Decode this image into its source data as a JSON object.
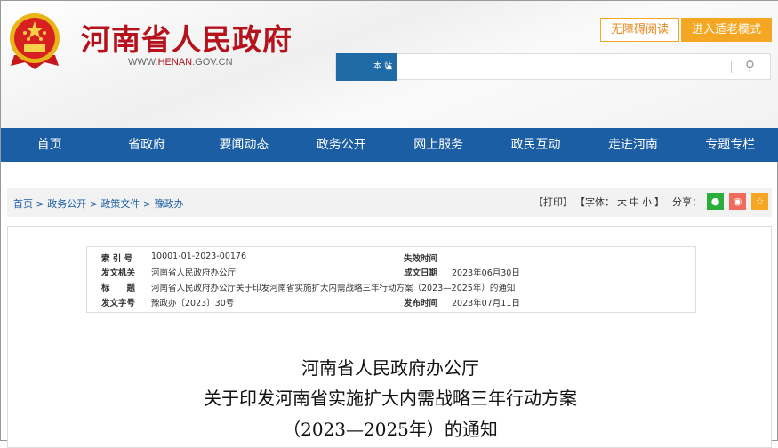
{
  "header": {
    "title": "河南省人民政府",
    "url_prefix": "WWW.",
    "url_mid": "HENAN",
    "url_suffix": ".GOV.CN",
    "accessible_label": "无障碍阅读",
    "elder_label": "进入适老模式",
    "search_scope": "本 站",
    "search_placeholder": ""
  },
  "nav": [
    "首页",
    "省政府",
    "要闻动态",
    "政务公开",
    "网上服务",
    "政民互动",
    "走进河南",
    "专题专栏"
  ],
  "breadcrumb": [
    "首页",
    "政务公开",
    "政策文件",
    "豫政办"
  ],
  "tools": {
    "print": "【打印】",
    "font_label": "【字体：",
    "large": "大",
    "medium": "中",
    "small": "小",
    "font_end": "】",
    "share": "分享："
  },
  "meta": {
    "index_label": "索 引 号",
    "index": "10001-01-2023-00176",
    "expire_label": "失效时间",
    "expire": "",
    "issuer_label": "发文机关",
    "issuer": "河南省人民政府办公厅",
    "date_label": "成文日期",
    "date": "2023年06月30日",
    "title_label": "标　　题",
    "title": "河南省人民政府办公厅关于印发河南省实施扩大内需战略三年行动方案（2023—2025年）的通知",
    "docno_label": "发文字号",
    "docno": "豫政办〔2023〕30号",
    "publish_label": "发布时间",
    "publish": "2023年07月11日"
  },
  "doc_title": [
    "河南省人民政府办公厅",
    "关于印发河南省实施扩大内需战略三年行动方案",
    "（2023—2025年）的通知"
  ]
}
